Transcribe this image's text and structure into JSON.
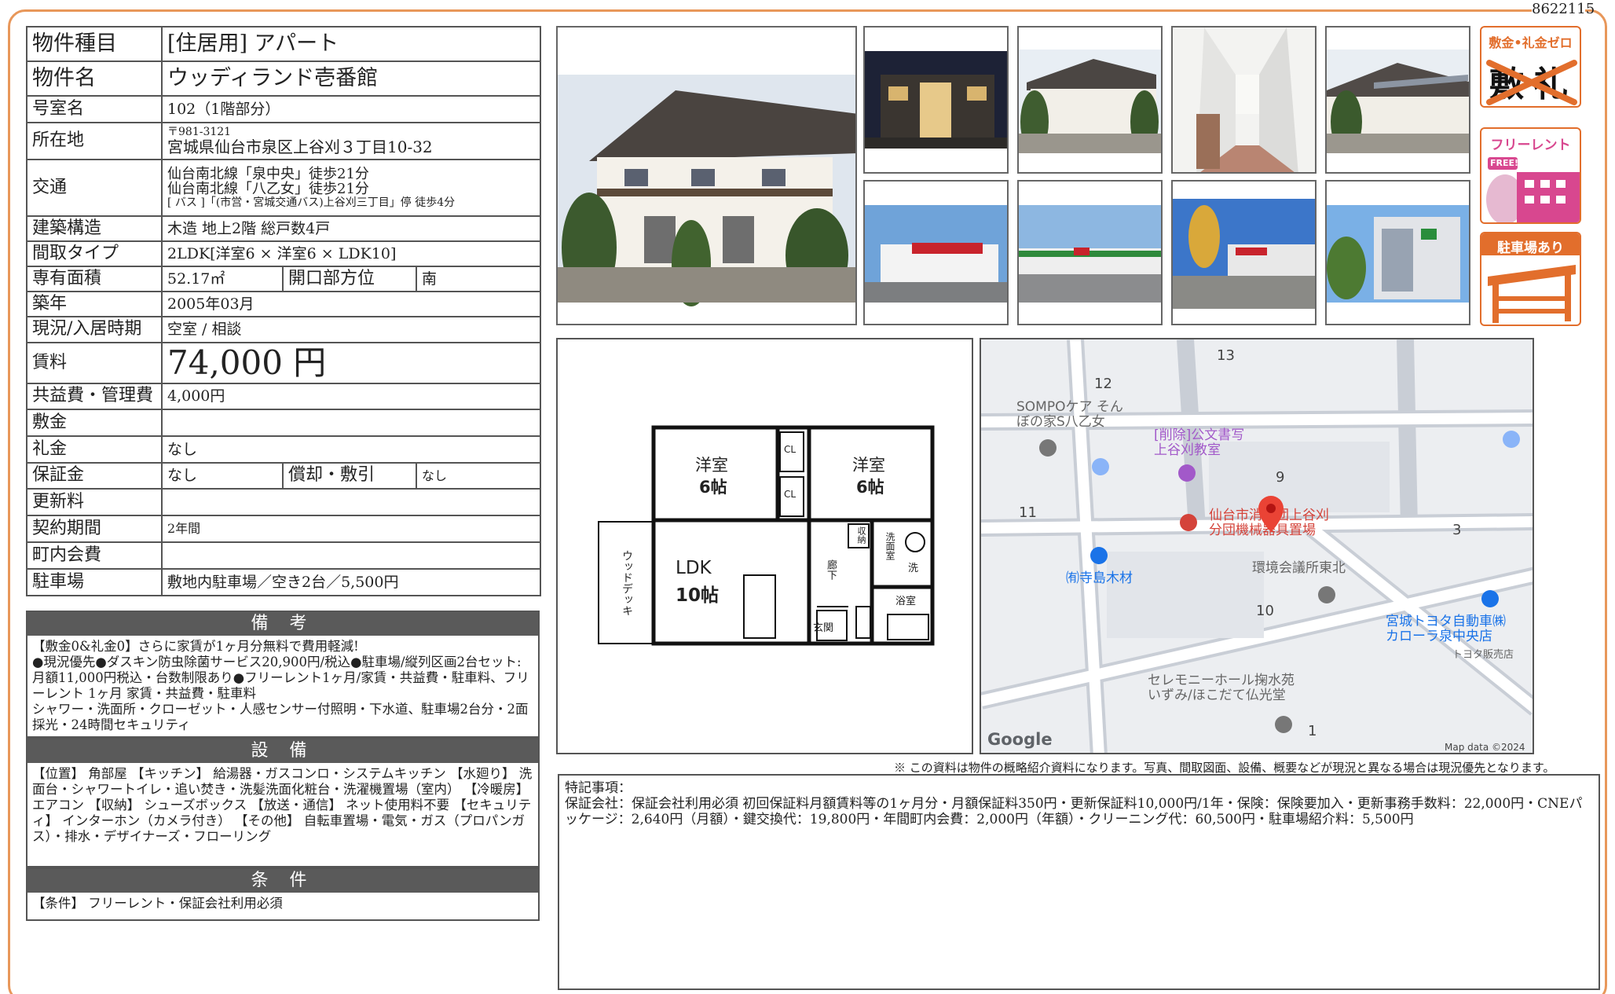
{
  "doc_id": "8622115",
  "spec": {
    "type_label": "物件種目",
    "type_value": "[住居用] アパート",
    "name_label": "物件名",
    "name_value": "ウッディランド壱番館",
    "room_label": "号室名",
    "room_value": "102（1階部分）",
    "address_label": "所在地",
    "postal": "〒981-3121",
    "address": "宮城県仙台市泉区上谷刈３丁目10-32",
    "access_label": "交通",
    "access_1": "仙台南北線「泉中央」徒歩21分",
    "access_2": "仙台南北線「八乙女」徒歩21分",
    "access_3": "[ バス ]「(市営・宮城交通バス)上谷刈三丁目」停 徒歩4分",
    "structure_label": "建築構造",
    "structure_value": "木造 地上2階 総戸数4戸",
    "layout_label": "間取タイプ",
    "layout_value": "2LDK[洋室6 × 洋室6 × LDK10]",
    "area_label": "専有面積",
    "area_value": "52.17㎡",
    "direction_label": "開口部方位",
    "direction_value": "南",
    "built_label": "築年",
    "built_value": "2005年03月",
    "status_label": "現況/入居時期",
    "status_value": "空室 / 相談",
    "rent_label": "賃料",
    "rent_value": "74,000 円",
    "fee_label": "共益費・管理費",
    "fee_value": "4,000円",
    "deposit_label": "敷金",
    "deposit_value": "",
    "key_money_label": "礼金",
    "key_money_value": "なし",
    "guarantee_label": "保証金",
    "guarantee_value": "なし",
    "amortize_label": "償却・敷引",
    "amortize_value": "なし",
    "renewal_label": "更新料",
    "renewal_value": "",
    "contract_label": "契約期間",
    "contract_value": "2年間",
    "community_label": "町内会費",
    "community_value": "",
    "parking_label": "駐車場",
    "parking_value": "敷地内駐車場／空き2台／5,500円"
  },
  "notes": {
    "title": "備 考",
    "body": "【敷金0&礼金0】さらに家賃が1ヶ月分無料で費用軽減!\n●現況優先●ダスキン防虫除菌サービス20,900円/税込●駐車場/縦列区画2台セット:月額11,000円税込・台数制限あり●フリーレント1ヶ月/家賃・共益費・駐車料、フリーレント 1ヶ月 家賃・共益費・駐車料\nシャワー・洗面所・クローゼット・人感センサー付照明・下水道、駐車場2台分・2面採光・24時間セキュリティ"
  },
  "facilities": {
    "title": "設 備",
    "body": "【位置】 角部屋 【キッチン】 給湯器・ガスコンロ・システムキッチン 【水廻り】 洗面台・シャワートイレ・追い焚き・洗髪洗面化粧台・洗濯機置場（室内） 【冷暖房】 エアコン 【収納】 シューズボックス 【放送・通信】 ネット使用料不要 【セキュリティ】 インターホン（カメラ付き） 【その他】 自転車置場・電気・ガス（プロパンガス）・排水・デザイナーズ・フローリング"
  },
  "conditions": {
    "title": "条 件",
    "body": "【条件】 フリーレント・保証会社利用必須"
  },
  "badges": {
    "zero": "敷金•礼金ゼロ",
    "zero_mark_1": "敷",
    "zero_mark_2": "礼",
    "free_rent": "フリーレント",
    "free_tag": "FREE!",
    "parking": "駐車場あり"
  },
  "floorplan": {
    "room1": "洋室",
    "room1_size": "6帖",
    "room2": "洋室",
    "room2_size": "6帖",
    "ldk": "LDK",
    "ldk_size": "10帖",
    "deck": "ウッドデッキ",
    "cl": "CL",
    "storage": "収納",
    "washroom": "洗面室",
    "laundry": "洗",
    "bath": "浴室",
    "hall": "廊下",
    "entrance": "玄関"
  },
  "map": {
    "labels": {
      "sompo": "SOMPOケア そん\nぼの家S八乙女",
      "kumon": "[削除]公文書写\n上谷刈教室",
      "fire": "仙台市消防団上谷刈\n分団機械器具置場",
      "kankyo": "環境会議所東北",
      "terashima": "㈲寺島木材",
      "toyota": "宮城トヨタ自動車㈱\nカローラ泉中央店",
      "toyota_sub": "トヨタ販売店",
      "ceremony": "セレモニーホール掬水苑\nいずみ/ほこだて仏光堂",
      "google": "Google",
      "mapdata": "Map data ©2024"
    },
    "numbers": [
      "13",
      "12",
      "9",
      "11",
      "3",
      "10",
      "1"
    ]
  },
  "notice": "※ この資料は物件の概略紹介資料になります。写真、間取図面、設備、概要などが現況と異なる場合は現況優先となります。",
  "remarks": {
    "title": "特記事項：",
    "body": "保証会社：保証会社利用必須 初回保証料月額賃料等の1ヶ月分・月額保証料350円・更新保証料10,000円/1年・保険：保険要加入・更新事務手数料：22,000円・CNEパッケージ：2,640円（月額）・鍵交換代：19,800円・年間町内会費：2,000円（年額）・クリーニング代：60,500円・駐車場紹介料：5,500円"
  }
}
